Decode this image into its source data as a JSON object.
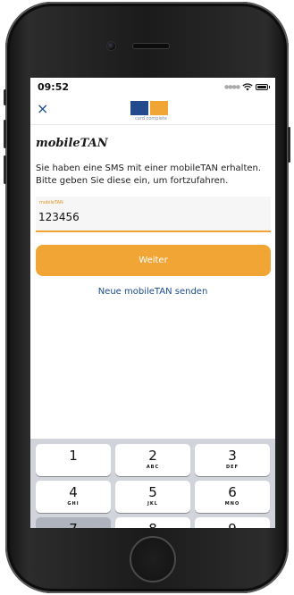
{
  "status_bar": {
    "time": "09:52"
  },
  "nav": {
    "close_label": "×",
    "logo_text": "card complete",
    "logo_colors": [
      "#224a8c",
      "#f0a535"
    ]
  },
  "page": {
    "title": "mobileTAN",
    "instructions": "Sie haben eine SMS mit einer mobileTAN erhalten. Bitte geben Sie diese ein, um fortzufahren."
  },
  "tan_input": {
    "label": "mobileTAN",
    "value": "123456"
  },
  "primary_button": {
    "label": "Weiter",
    "color": "#f0a535"
  },
  "resend_link": {
    "label": "Neue mobileTAN senden",
    "color": "#1d4c8c"
  },
  "keyboard": {
    "keys": [
      {
        "digit": "1",
        "letters": ""
      },
      {
        "digit": "2",
        "letters": "ABC"
      },
      {
        "digit": "3",
        "letters": "DEF"
      },
      {
        "digit": "4",
        "letters": "GHI"
      },
      {
        "digit": "5",
        "letters": "JKL"
      },
      {
        "digit": "6",
        "letters": "MNO"
      },
      {
        "digit": "7",
        "letters": ""
      },
      {
        "digit": "8",
        "letters": ""
      },
      {
        "digit": "9",
        "letters": ""
      }
    ]
  }
}
